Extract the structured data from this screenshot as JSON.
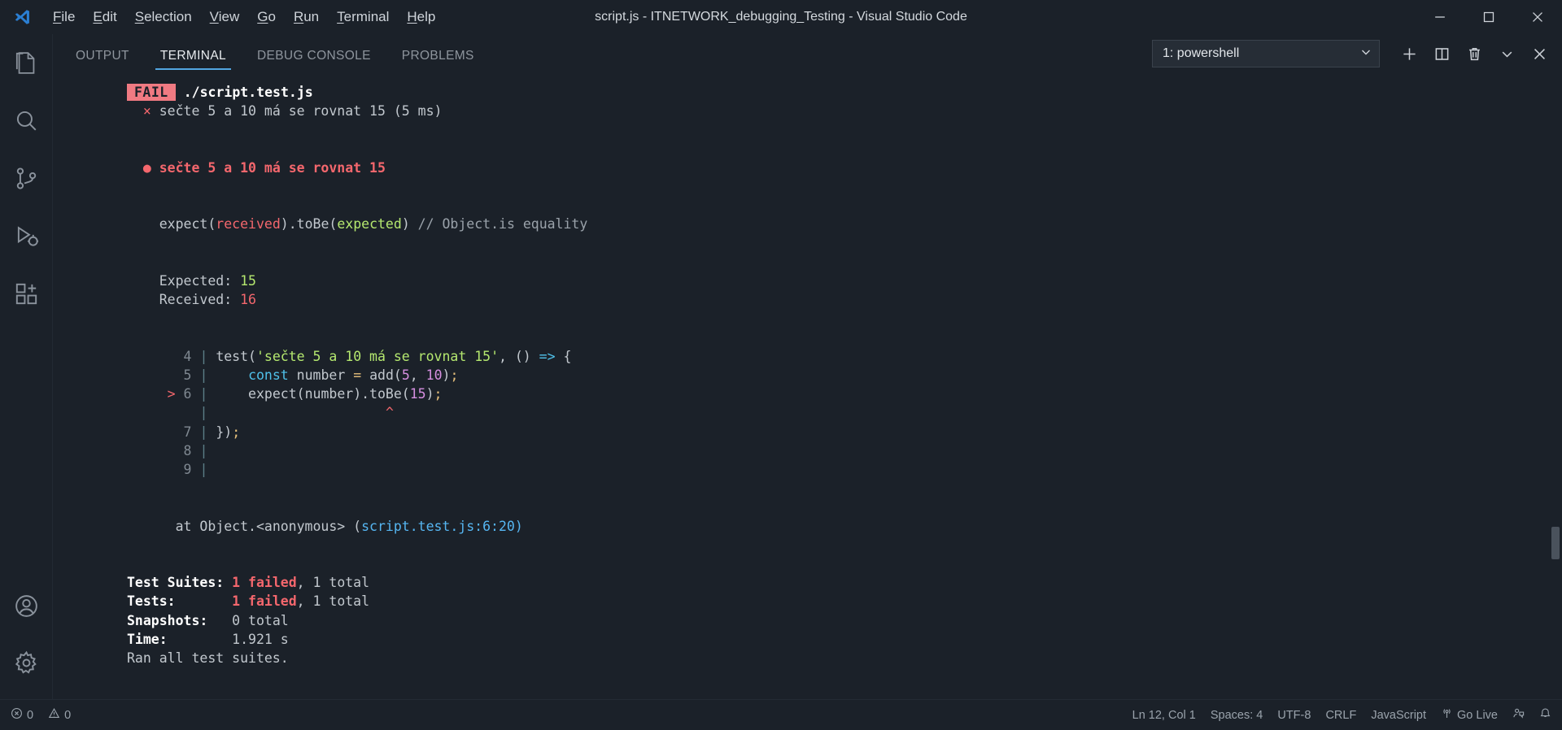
{
  "titlebar": {
    "logo_icon": "vscode-logo-icon",
    "menu": [
      {
        "pre": "",
        "accel": "F",
        "post": "ile"
      },
      {
        "pre": "",
        "accel": "E",
        "post": "dit"
      },
      {
        "pre": "",
        "accel": "S",
        "post": "election"
      },
      {
        "pre": "",
        "accel": "V",
        "post": "iew"
      },
      {
        "pre": "",
        "accel": "G",
        "post": "o"
      },
      {
        "pre": "",
        "accel": "R",
        "post": "un"
      },
      {
        "pre": "",
        "accel": "T",
        "post": "erminal"
      },
      {
        "pre": "",
        "accel": "H",
        "post": "elp"
      }
    ],
    "title": "script.js - ITNETWORK_debugging_Testing - Visual Studio Code",
    "minimize_label": "Minimize",
    "maximize_label": "Maximize",
    "close_label": "Close"
  },
  "activitybar": {
    "items": [
      {
        "name": "explorer",
        "icon": "files-icon",
        "active": false
      },
      {
        "name": "search",
        "icon": "search-icon",
        "active": false
      },
      {
        "name": "source-control",
        "icon": "source-control-icon",
        "active": false
      },
      {
        "name": "run-and-debug",
        "icon": "run-debug-icon",
        "active": false
      },
      {
        "name": "extensions",
        "icon": "extensions-icon",
        "active": false
      }
    ],
    "bottom": [
      {
        "name": "accounts",
        "icon": "account-icon"
      },
      {
        "name": "manage",
        "icon": "gear-icon"
      }
    ]
  },
  "panel": {
    "tabs": [
      {
        "label": "OUTPUT",
        "active": false
      },
      {
        "label": "TERMINAL",
        "active": true
      },
      {
        "label": "DEBUG CONSOLE",
        "active": false
      },
      {
        "label": "PROBLEMS",
        "active": false
      }
    ],
    "terminal_select": "1: powershell",
    "actions": [
      {
        "name": "new-terminal",
        "icon": "plus-icon",
        "label": "New Terminal"
      },
      {
        "name": "split-terminal",
        "icon": "split-icon",
        "label": "Split Terminal"
      },
      {
        "name": "kill-terminal",
        "icon": "trash-icon",
        "label": "Kill Terminal"
      },
      {
        "name": "panel-views",
        "icon": "chevron-down-icon",
        "label": "Views and More Actions"
      },
      {
        "name": "close-panel",
        "icon": "close-icon",
        "label": "Close Panel"
      }
    ]
  },
  "terminal": {
    "fail_badge": "FAIL",
    "fail_file": "./script.test.js",
    "test_cross": "×",
    "test_line": "sečte 5 a 10 má se rovnat 15 (5 ms)",
    "bullet": "●",
    "error_title": "sečte 5 a 10 má se rovnat 15",
    "matcher": {
      "p1": "expect(",
      "received": "received",
      "p2": ").toBe(",
      "expected": "expected",
      "p3": ")",
      "comment": " // Object.is equality"
    },
    "expected_label": "Expected: ",
    "expected_value": "15",
    "received_label": "Received: ",
    "received_value": "16",
    "code": [
      {
        "marker": "",
        "num": "4",
        "bar": "|",
        "segments": [
          {
            "t": "test(",
            "c": "grey"
          },
          {
            "t": "'sečte 5 a 10 má se rovnat 15'",
            "c": "green"
          },
          {
            "t": ", () ",
            "c": "grey"
          },
          {
            "t": "=>",
            "c": "cyan"
          },
          {
            "t": " {",
            "c": "grey"
          }
        ]
      },
      {
        "marker": "",
        "num": "5",
        "bar": "|",
        "segments": [
          {
            "t": "    ",
            "c": "grey"
          },
          {
            "t": "const",
            "c": "cyan"
          },
          {
            "t": " number ",
            "c": "grey"
          },
          {
            "t": "=",
            "c": "yellow"
          },
          {
            "t": " add(",
            "c": "grey"
          },
          {
            "t": "5",
            "c": "mag"
          },
          {
            "t": ", ",
            "c": "grey"
          },
          {
            "t": "10",
            "c": "mag"
          },
          {
            "t": ")",
            "c": "grey"
          },
          {
            "t": ";",
            "c": "yellow"
          }
        ]
      },
      {
        "marker": ">",
        "num": "6",
        "bar": "|",
        "segments": [
          {
            "t": "    expect(number).toBe(",
            "c": "grey"
          },
          {
            "t": "15",
            "c": "mag"
          },
          {
            "t": ")",
            "c": "grey"
          },
          {
            "t": ";",
            "c": "yellow"
          }
        ]
      },
      {
        "marker": "",
        "num": " ",
        "bar": "|",
        "segments": [
          {
            "t": "                     ",
            "c": "grey"
          },
          {
            "t": "^",
            "c": "caret"
          }
        ]
      },
      {
        "marker": "",
        "num": "7",
        "bar": "|",
        "segments": [
          {
            "t": "})",
            "c": "grey"
          },
          {
            "t": ";",
            "c": "yellow"
          }
        ]
      },
      {
        "marker": "",
        "num": "8",
        "bar": "|",
        "segments": [
          {
            "t": "",
            "c": "grey"
          }
        ]
      },
      {
        "marker": "",
        "num": "9",
        "bar": "|",
        "segments": [
          {
            "t": "",
            "c": "grey"
          }
        ]
      }
    ],
    "stack": {
      "pre": "at Object.<anonymous> (",
      "file": "script.test.js",
      "post": ":6:20)"
    },
    "summary": [
      {
        "label": "Test Suites:",
        "pad": " ",
        "failed": "1 failed",
        "sep": ", ",
        "total": "1 total"
      },
      {
        "label": "Tests:",
        "pad": "       ",
        "failed": "1 failed",
        "sep": ", ",
        "total": "1 total"
      },
      {
        "label": "Snapshots:",
        "pad": "   ",
        "failed": "",
        "sep": "",
        "total": "0 total"
      },
      {
        "label": "Time:",
        "pad": "        ",
        "failed": "",
        "sep": "",
        "total": "1.921 s"
      }
    ],
    "footer": "Ran all test suites."
  },
  "statusbar": {
    "left": [
      {
        "name": "errors",
        "icon": "error-circle-icon",
        "label": "0"
      },
      {
        "name": "warnings",
        "icon": "warning-triangle-icon",
        "label": "0"
      }
    ],
    "right": [
      {
        "name": "cursor-position",
        "icon": "",
        "label": "Ln 12, Col 1"
      },
      {
        "name": "indentation",
        "icon": "",
        "label": "Spaces: 4"
      },
      {
        "name": "encoding",
        "icon": "",
        "label": "UTF-8"
      },
      {
        "name": "eol",
        "icon": "",
        "label": "CRLF"
      },
      {
        "name": "language-mode",
        "icon": "",
        "label": "JavaScript"
      },
      {
        "name": "go-live",
        "icon": "broadcast-icon",
        "label": "Go Live"
      },
      {
        "name": "feedback",
        "icon": "feedback-icon",
        "label": ""
      },
      {
        "name": "notifications",
        "icon": "bell-icon",
        "label": ""
      }
    ]
  },
  "colors": {
    "background": "#1b2129",
    "accent": "#52a6e0",
    "fail_badge_bg": "#f07a82",
    "error_red": "#f4676d",
    "string_green": "#b5e86f",
    "number_magenta": "#d68fe0",
    "keyword_cyan": "#4fc1ea"
  }
}
